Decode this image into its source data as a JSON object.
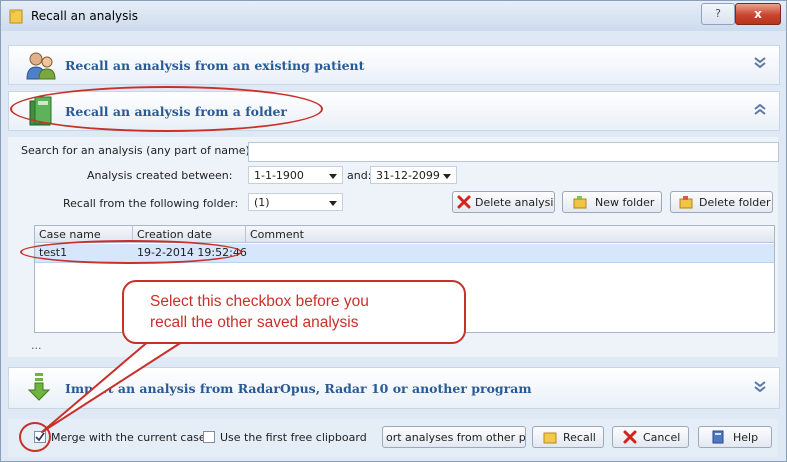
{
  "window": {
    "title": "Recall an analysis",
    "help_glyph": "?",
    "close_glyph": "x"
  },
  "panels": {
    "patient": {
      "title": "Recall an analysis from an existing patient",
      "icon": "patients-icon"
    },
    "folder": {
      "title": "Recall an analysis from a folder",
      "icon": "folder-book-icon"
    },
    "import": {
      "title": "Import an analysis from RadarOpus, Radar 10 or another program",
      "icon": "import-arrow-icon"
    }
  },
  "search": {
    "label": "Search for an analysis (any part of name):",
    "value": ""
  },
  "dates": {
    "label": "Analysis created between:",
    "from": "1-1-1900",
    "and_label": "and:",
    "to": "31-12-2099"
  },
  "folder_select": {
    "label": "Recall from the following folder:",
    "value": "(1)"
  },
  "folder_buttons": {
    "delete_analysis": "Delete analysis",
    "new_folder": "New folder",
    "delete_folder": "Delete folder"
  },
  "table": {
    "columns": [
      "Case name",
      "Creation date",
      "Comment"
    ],
    "rows": [
      {
        "case_name": "test1",
        "creation_date": "19-2-2014 19:52:46",
        "comment": ""
      }
    ]
  },
  "more_indicator": "...",
  "callout": {
    "line1": "Select this checkbox before you",
    "line2": "recall the other saved analysis"
  },
  "bottom": {
    "merge_label": "Merge with the current case",
    "merge_checked": true,
    "clipboard_label": "Use the first free clipboard",
    "clipboard_checked": false,
    "import_button": "ort analyses from other progra",
    "recall": "Recall",
    "cancel": "Cancel",
    "help": "Help"
  },
  "colors": {
    "callout_red": "#c8302a",
    "panel_title_blue": "#2a5a93",
    "selected_row": "#d6e7fb"
  }
}
